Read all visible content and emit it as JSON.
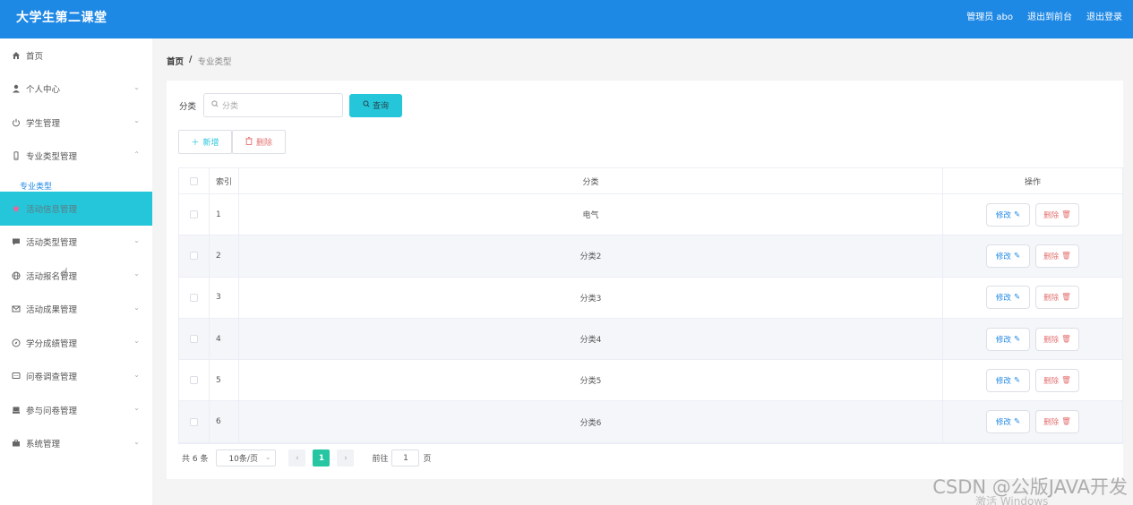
{
  "header": {
    "title": "大学生第二课堂",
    "admin": "管理员 abo",
    "to_front": "退出到前台",
    "logout": "退出登录"
  },
  "sidebar": {
    "items": [
      {
        "label": "首页",
        "icon": "home-icon",
        "arrow": ""
      },
      {
        "label": "个人中心",
        "icon": "user-icon",
        "arrow": "⌄"
      },
      {
        "label": "学生管理",
        "icon": "power-icon",
        "arrow": "⌄"
      },
      {
        "label": "专业类型管理",
        "icon": "phone-icon",
        "arrow": "⌃"
      },
      {
        "label": "活动信息管理",
        "icon": "star-icon",
        "arrow": ""
      },
      {
        "label": "活动类型管理",
        "icon": "chat-icon",
        "arrow": "⌄"
      },
      {
        "label": "活动报名管理",
        "icon": "globe-icon",
        "arrow": "⌄"
      },
      {
        "label": "活动成果管理",
        "icon": "mail-icon",
        "arrow": "⌄"
      },
      {
        "label": "学分成绩管理",
        "icon": "compass-icon",
        "arrow": "⌄"
      },
      {
        "label": "问卷调查管理",
        "icon": "message-icon",
        "arrow": "⌄"
      },
      {
        "label": "参与问卷管理",
        "icon": "box-icon",
        "arrow": "⌄"
      },
      {
        "label": "系统管理",
        "icon": "briefcase-icon",
        "arrow": "⌄"
      }
    ],
    "sub_item": "专业类型"
  },
  "breadcrumb": {
    "home": "首页",
    "sep": "/",
    "current": "专业类型"
  },
  "search": {
    "label": "分类",
    "placeholder": "分类",
    "button": "查询"
  },
  "actions": {
    "add": "新增",
    "delete": "删除"
  },
  "table": {
    "headers": {
      "index": "索引",
      "category": "分类",
      "ops": "操作"
    },
    "rows": [
      {
        "index": "1",
        "category": "电气"
      },
      {
        "index": "2",
        "category": "分类2"
      },
      {
        "index": "3",
        "category": "分类3"
      },
      {
        "index": "4",
        "category": "分类4"
      },
      {
        "index": "5",
        "category": "分类5"
      },
      {
        "index": "6",
        "category": "分类6"
      }
    ],
    "edit_label": "修改",
    "remove_label": "删除"
  },
  "pagination": {
    "total": "共 6 条",
    "page_size": "10条/页",
    "current_page": "1",
    "goto_label": "前往",
    "goto_value": "1",
    "page_suffix": "页"
  },
  "watermark": "CSDN @公版JAVA开发",
  "win_watermark": "激活 Windows",
  "colors": {
    "header": "#1e88e5",
    "accent": "#26c6da",
    "page_active": "#26c6a2",
    "danger": "#e57373"
  }
}
